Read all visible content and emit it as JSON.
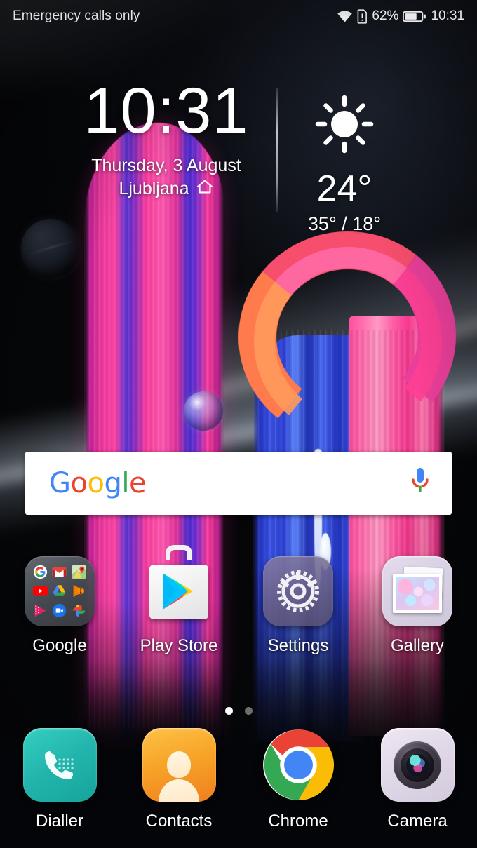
{
  "status_bar": {
    "carrier_text": "Emergency calls only",
    "wifi_icon": "wifi-icon",
    "sim_icon": "sim-card-alert-icon",
    "battery_percent": "62%",
    "battery_level": 62,
    "battery_icon": "battery-icon",
    "clock": "10:31"
  },
  "clock_widget": {
    "time": "10:31",
    "date": "Thursday, 3 August",
    "city": "Ljubljana",
    "home_icon": "home-icon"
  },
  "weather_widget": {
    "condition_icon": "sunny-icon",
    "temperature": "24°",
    "range": "35° / 18°"
  },
  "search_bar": {
    "logo_letters": [
      "G",
      "o",
      "o",
      "g",
      "l",
      "e"
    ],
    "logo_colors": [
      "#4285F4",
      "#EA4335",
      "#FBBC05",
      "#4285F4",
      "#34A853",
      "#EA4335"
    ],
    "mic_icon": "microphone-icon",
    "placeholder": ""
  },
  "app_grid": [
    {
      "label": "Google",
      "icon": "google-folder-icon",
      "type": "folder",
      "folder_apps": [
        {
          "name": "google-search-icon"
        },
        {
          "name": "gmail-icon"
        },
        {
          "name": "google-maps-icon"
        },
        {
          "name": "youtube-icon"
        },
        {
          "name": "google-drive-icon"
        },
        {
          "name": "play-music-icon"
        },
        {
          "name": "play-movies-icon"
        },
        {
          "name": "google-duo-icon"
        },
        {
          "name": "google-photos-icon"
        }
      ]
    },
    {
      "label": "Play Store",
      "icon": "play-store-icon",
      "type": "app"
    },
    {
      "label": "Settings",
      "icon": "settings-gear-icon",
      "type": "app"
    },
    {
      "label": "Gallery",
      "icon": "gallery-icon",
      "type": "app"
    }
  ],
  "dock": [
    {
      "label": "Dialler",
      "icon": "phone-icon"
    },
    {
      "label": "Contacts",
      "icon": "contacts-person-icon"
    },
    {
      "label": "Chrome",
      "icon": "chrome-icon"
    },
    {
      "label": "Camera",
      "icon": "camera-lens-icon"
    }
  ],
  "page_indicator": {
    "total_pages": 2,
    "current_page": 1
  },
  "colors": {
    "background": "#050608",
    "text_primary": "#ffffff",
    "status_text": "#e8e8e8",
    "search_bar_bg": "#ffffff",
    "dot_active": "#ffffff",
    "dot_inactive": "#6e6e6e",
    "dialler": "#23b5ad",
    "contacts": "#f7a428",
    "settings": "#6c6389",
    "gallery": "#d9d2e4",
    "camera": "#e2dae9"
  }
}
